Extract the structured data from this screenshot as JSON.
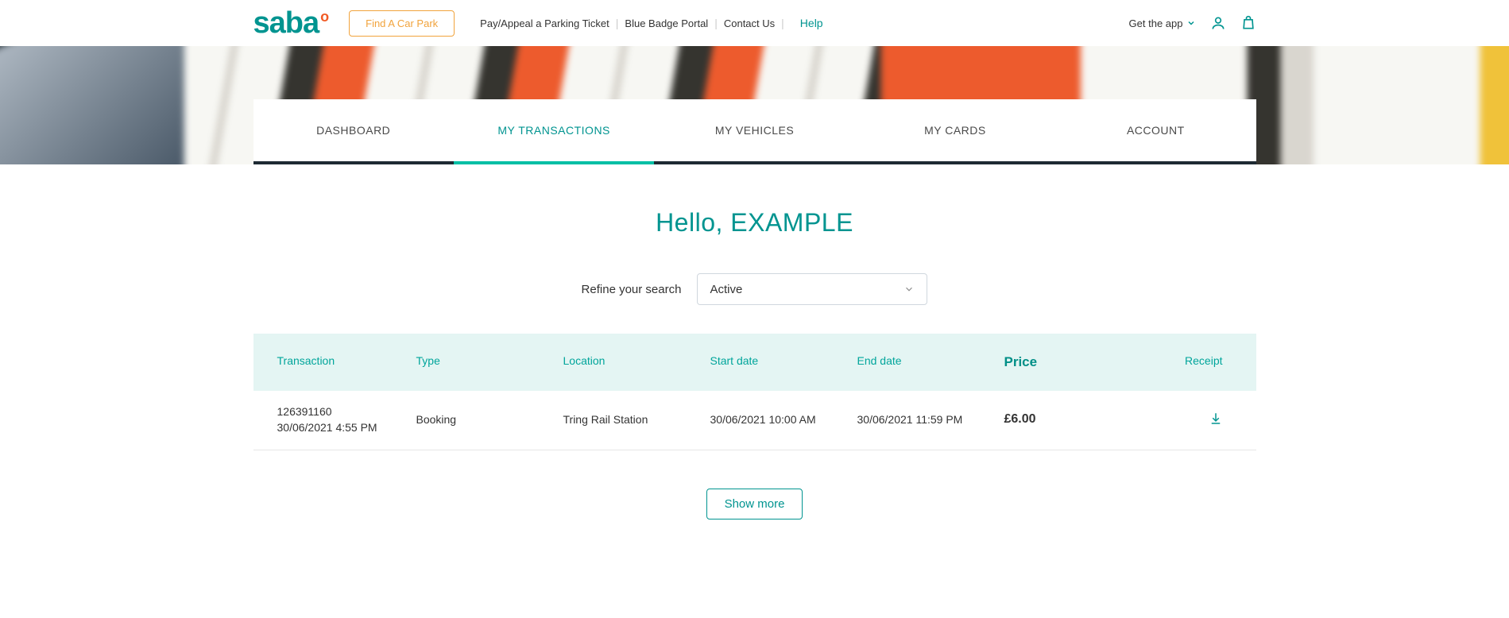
{
  "header": {
    "logo_text": "saba",
    "find_button": "Find A Car Park",
    "links": {
      "pay": "Pay/Appeal a Parking Ticket",
      "blue": "Blue Badge Portal",
      "contact": "Contact Us",
      "help": "Help"
    },
    "get_app": "Get the app"
  },
  "tabs": {
    "dashboard": "DASHBOARD",
    "transactions": "MY TRANSACTIONS",
    "vehicles": "MY VEHICLES",
    "cards": "MY CARDS",
    "account": "ACCOUNT"
  },
  "greeting": "Hello, EXAMPLE",
  "refine": {
    "label": "Refine your search",
    "selected": "Active"
  },
  "table": {
    "headers": {
      "transaction": "Transaction",
      "type": "Type",
      "location": "Location",
      "start": "Start date",
      "end": "End date",
      "price": "Price",
      "receipt": "Receipt"
    },
    "rows": [
      {
        "id": "126391160",
        "ts": "30/06/2021 4:55 PM",
        "type": "Booking",
        "location": "Tring Rail Station",
        "start": "30/06/2021 10:00 AM",
        "end": "30/06/2021 11:59 PM",
        "price": "£6.00"
      }
    ]
  },
  "show_more": "Show more"
}
